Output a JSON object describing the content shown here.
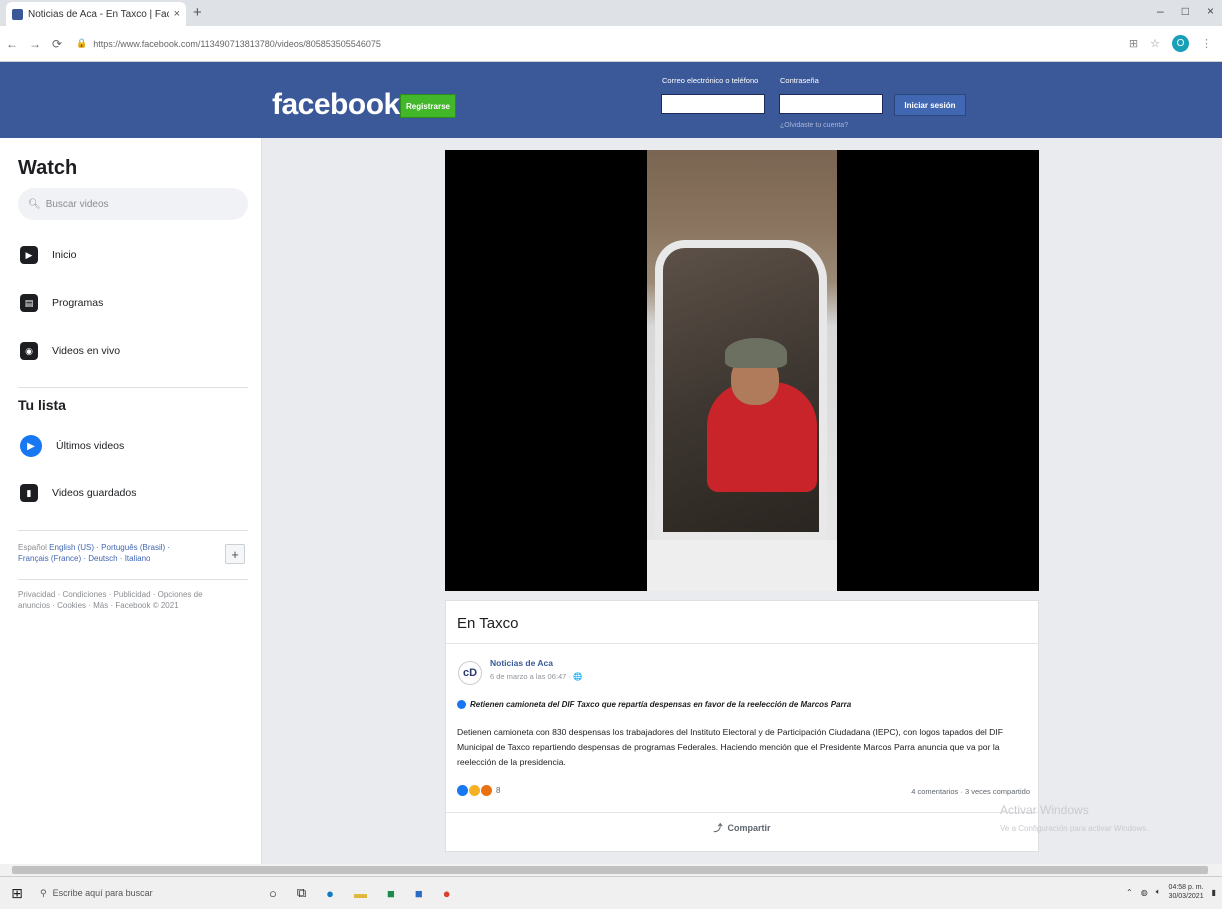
{
  "browser": {
    "tab_title": "Noticias de Aca - En Taxco | Fac",
    "tab_close": "×",
    "new_tab": "+",
    "url": "https://www.facebook.com/113490713813780/videos/805853505546075",
    "win_min": "–",
    "win_max": "□",
    "win_close": "×",
    "profile_initial": "O"
  },
  "header": {
    "logo": "facebook",
    "register_label": "Registrarse",
    "email_label": "Correo electrónico o teléfono",
    "password_label": "Contraseña",
    "login_label": "Iniciar sesión",
    "forgot_label": "¿Olvidaste tu cuenta?"
  },
  "sidebar": {
    "title": "Watch",
    "search_placeholder": "Buscar videos",
    "items": [
      {
        "label": "Inicio",
        "icon": "home-icon"
      },
      {
        "label": "Programas",
        "icon": "shows-icon"
      },
      {
        "label": "Videos en vivo",
        "icon": "live-icon"
      }
    ],
    "list_title": "Tu lista",
    "list_items": [
      {
        "label": "Últimos videos",
        "icon": "latest-videos-icon"
      },
      {
        "label": "Videos guardados",
        "icon": "saved-icon"
      }
    ],
    "langs_current": "Español",
    "langs": "English (US) · Português (Brasil) · Français (France) · Deutsch · Italiano",
    "footer": "Privacidad · Condiciones · Publicidad · Opciones de anuncios · Cookies · Más · Facebook © 2021"
  },
  "post": {
    "title": "En Taxco",
    "page_name": "Noticias de Aca",
    "time": "6 de marzo a las 06:47 · 🌐",
    "avatar_text": "cD",
    "headline": "Retienen camioneta del DIF Taxco que repartía despensas en favor de la reelección de Marcos Parra",
    "body": "Detienen camioneta con 830 despensas los trabajadores del Instituto Electoral y de Participación Ciudadana (IEPC), con logos tapados del DIF Municipal de Taxco repartiendo despensas de programas Federales. Haciendo mención que el Presidente Marcos Parra anuncia que va por la reelección de la presidencia.",
    "reaction_count": "8",
    "stats": "4 comentarios · 3 veces compartido",
    "share_label": "Compartir"
  },
  "watermark": {
    "line1": "Activar Windows",
    "line2": "Ve a Configuración para activar Windows."
  },
  "taskbar": {
    "search_placeholder": "Escribe aquí para buscar",
    "time": "04:58 p. m.",
    "date": "30/03/2021"
  }
}
